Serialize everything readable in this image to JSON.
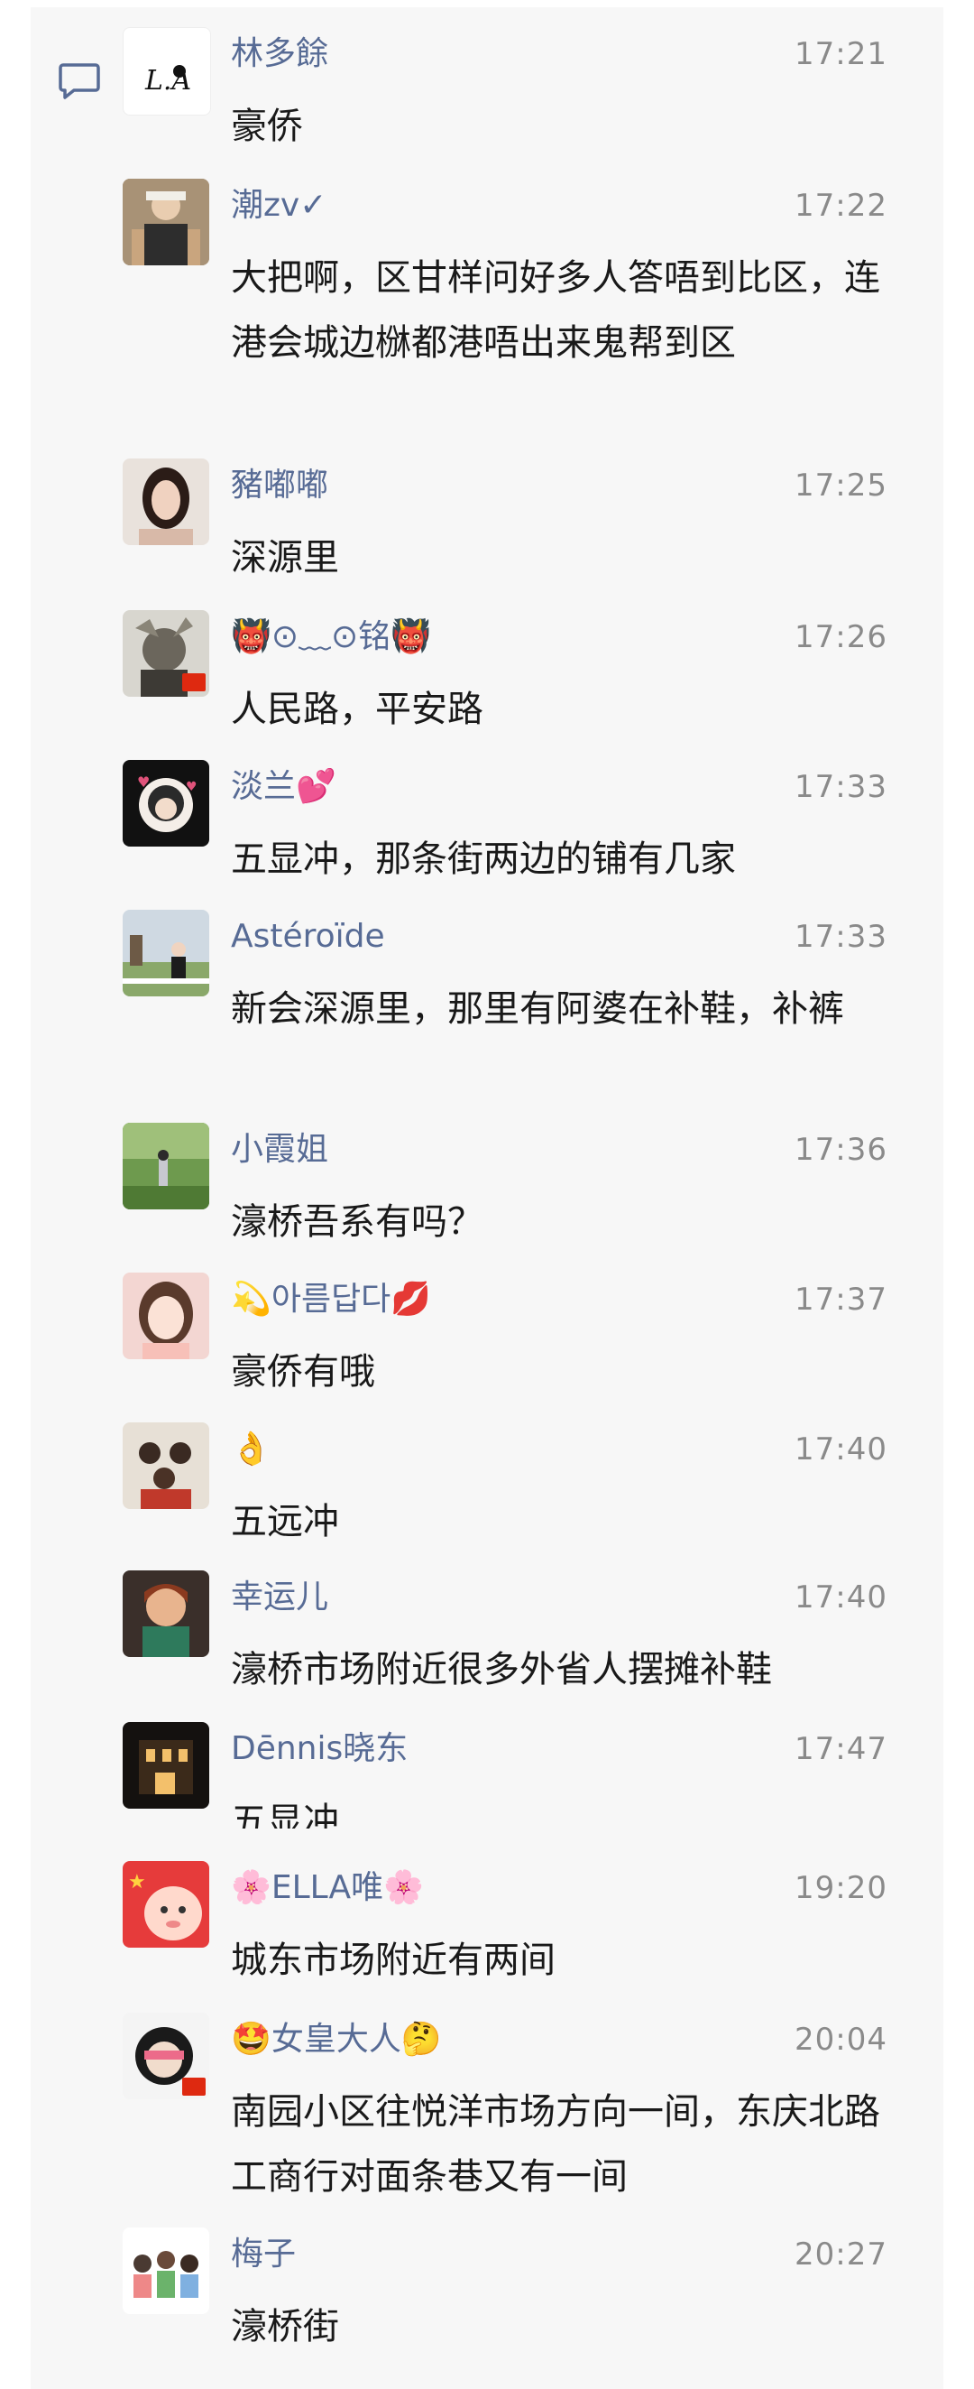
{
  "colors": {
    "name": "#576b95",
    "time": "#8a8a8a",
    "text": "#191919",
    "bg": "#f7f7f7"
  },
  "icons": {
    "header": "comment-icon"
  },
  "comments": [
    {
      "name": "林多餘",
      "time": "17:21",
      "text": "豪侨",
      "avatar_label": "L.A"
    },
    {
      "name": "潮zv✓",
      "time": "17:22",
      "text": "大把啊，区甘样问好多人答唔到比区，连港会城边椕都港唔出来鬼帮到区"
    },
    {
      "name": "豬嘟嘟",
      "time": "17:25",
      "text": "深源里"
    },
    {
      "name": "👹⊙﹏⊙铭👹",
      "time": "17:26",
      "text": "人民路，平安路"
    },
    {
      "name": "淡兰💕",
      "time": "17:33",
      "text": "五显冲，那条街两边的铺有几家"
    },
    {
      "name": "Astéroïde",
      "time": "17:33",
      "text": "新会深源里，那里有阿婆在补鞋，补裤"
    },
    {
      "name": "小霞姐",
      "time": "17:36",
      "text": "濠桥吾系有吗？"
    },
    {
      "name": "💫아름답다💋",
      "time": "17:37",
      "text": "豪侨有哦"
    },
    {
      "name": "👌",
      "time": "17:40",
      "text": "五远冲"
    },
    {
      "name": "幸运儿",
      "time": "17:40",
      "text": "濠桥市场附近很多外省人摆摊补鞋"
    },
    {
      "name": "Dēnnis晓东",
      "time": "17:47",
      "text": "五显冲"
    },
    {
      "name": "🌸ELLA唯🌸",
      "time": "19:20",
      "text": "城东市场附近有两间"
    },
    {
      "name": "🤩女皇大人🤔",
      "time": "20:04",
      "text": "南园小区往悦洋市场方向一间，东庆北路工商行对面条巷又有一间"
    },
    {
      "name": "梅子",
      "time": "20:27",
      "text": "濠桥街"
    }
  ]
}
